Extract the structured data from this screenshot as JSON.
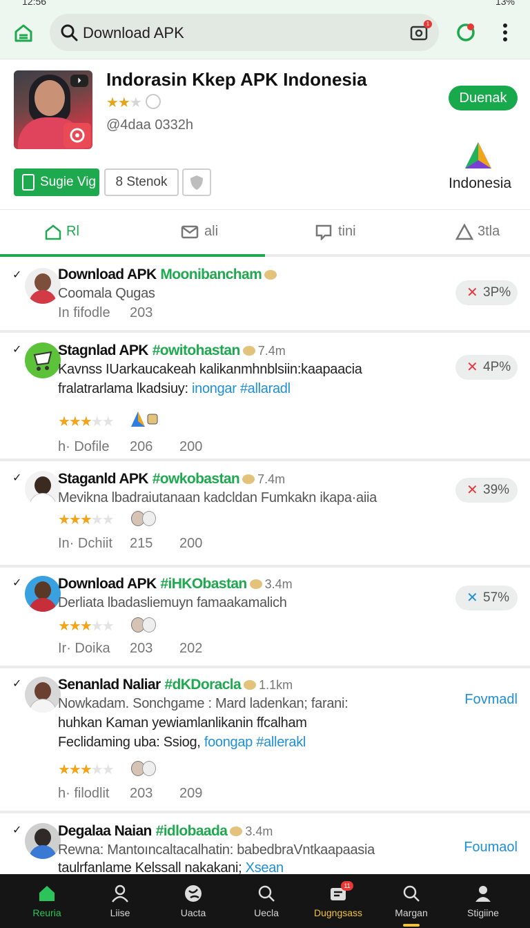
{
  "status": {
    "time": "12:56",
    "battery": "13%"
  },
  "search": {
    "query": "Download APK",
    "camera_badge": "1"
  },
  "header": {
    "title": "Indorasin Kkep APK Indonesia",
    "handle": "@4daa  0332h",
    "download_label": "Duenak",
    "follow_label": "Sugie Vig",
    "stock_label": "8 Stenok",
    "country": "Indonesia",
    "rating_filled": 2,
    "rating_total": 3
  },
  "tabs": [
    {
      "label": "Rl",
      "icon": "home-icon",
      "active": true
    },
    {
      "label": "ali",
      "icon": "mail-icon",
      "active": false
    },
    {
      "label": "tini",
      "icon": "message-icon",
      "active": false
    },
    {
      "label": "3tla",
      "icon": "triangle-icon",
      "active": false
    }
  ],
  "posts": [
    {
      "name": "Download APK",
      "tag": "Moonibancham",
      "time": "",
      "lines": [
        "Coomala Qugas"
      ],
      "rating": 0,
      "meta": [
        "In  fifodle",
        "203",
        ""
      ],
      "percent": "3P%",
      "action": "",
      "avatar_color": "#d23b45"
    },
    {
      "name": "Stagnlad APK",
      "tag": "#owitohastan",
      "time": "7.4m",
      "lines": [
        "Kavnss IUarkaucakeah kalikanmhnblsiin:kaapaacia"
      ],
      "line2_text": "fralatrarlama lkadsiuy: ",
      "line2_link": "inongar #allaradl",
      "rating": 2.5,
      "meta": [
        "h· Dofile",
        "206",
        "200"
      ],
      "percent": "4P%",
      "action": "",
      "avatar_color": "#5cc23a"
    },
    {
      "name": "Staganld APK",
      "tag": "#owkobastan",
      "time": "7.4m",
      "lines": [
        "Mevikna lbadraiutanaan kadcldan Fumkakn ikapa·aiia"
      ],
      "rating": 2.5,
      "meta": [
        "In· Dchiit",
        "215",
        "200"
      ],
      "percent": "39%",
      "action": "",
      "avatar_color": "#ffffff"
    },
    {
      "name": "Download APK",
      "tag": "#iHKObastan",
      "time": "3.4m",
      "lines": [
        "Derliata lbadasliemuyn famaakamalich"
      ],
      "rating": 2.5,
      "meta": [
        "Ir· Doika",
        "203",
        "202"
      ],
      "percent": "57%",
      "action": "",
      "avatar_color": "#c62e3a"
    },
    {
      "name": "Senanlad Naliar",
      "tag": "#dKDoracla",
      "time": "1.1km",
      "lines": [
        "Nowkadam. Sonchgame : Mard ladenkan; farani:",
        "huhkan Kaman yewiamlanlikanin ffcalham"
      ],
      "line2_text": "Feclidaming uba: Ssiog, ",
      "line2_link": "foongap #allerakl",
      "rating": 2.5,
      "meta": [
        "h· filodlit",
        "203",
        "209"
      ],
      "percent": "",
      "action": "Fovmadl",
      "avatar_color": "#f4f4f4"
    },
    {
      "name": "Degalaa Naian",
      "tag": "#idlobaada",
      "time": "3.4m",
      "lines": [
        "Rewna: Mantoıncaltacalhatin: babedbraVntkaapaasia"
      ],
      "line2_text": "taulrfanlame Kelssall nakakani; ",
      "line2_link": "Xsean",
      "rating": 0,
      "meta": [
        "",
        "",
        ""
      ],
      "percent": "",
      "action": "Foumaol",
      "avatar_color": "#3a79d4"
    }
  ],
  "bottom_nav": [
    {
      "label": "Reuria",
      "icon": "home-icon"
    },
    {
      "label": "Liise",
      "icon": "person-icon"
    },
    {
      "label": "Uacta",
      "icon": "globe-icon"
    },
    {
      "label": "Uecla",
      "icon": "search-icon"
    },
    {
      "label": "Dugngsass",
      "icon": "inbox-icon",
      "badge": "11"
    },
    {
      "label": "Margan",
      "icon": "search-icon"
    },
    {
      "label": "Stigiine",
      "icon": "profile-icon"
    }
  ],
  "colors": {
    "accent": "#1fa94f",
    "link": "#1e8fd8",
    "nav_bg": "#151515",
    "highlight": "#f3c23d",
    "error": "#e53940"
  }
}
